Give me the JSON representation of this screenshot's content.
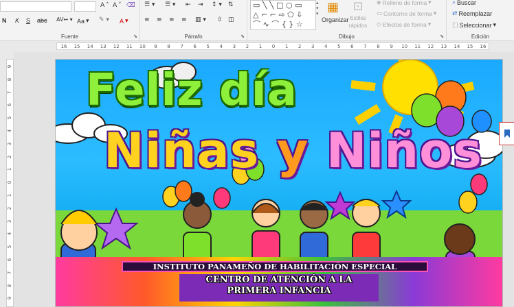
{
  "ribbon": {
    "groups": {
      "font_label": "Fuente",
      "paragraph_label": "Párrafo",
      "drawing_label": "Dibujo",
      "editing_label": "Edición"
    },
    "font": {
      "styles": [
        "N",
        "K",
        "S",
        "abc"
      ],
      "buttons": [
        "A",
        "A",
        "Aa",
        "A"
      ]
    },
    "drawing": {
      "arrange_label": "Organizar",
      "quick_styles_label": "Estilos rápidos",
      "shape_fill": "Relleno de forma",
      "shape_outline": "Contorno de forma",
      "shape_effects": "Efectos de forma"
    },
    "editing": {
      "find": "Buscar",
      "replace": "Reemplazar",
      "select": "Seleccionar"
    }
  },
  "ruler_h_ticks": [
    "16",
    "15",
    "14",
    "13",
    "12",
    "11",
    "10",
    "9",
    "8",
    "7",
    "6",
    "5",
    "4",
    "3",
    "2",
    "1",
    "0",
    "1",
    "2",
    "3",
    "4",
    "5",
    "6",
    "7",
    "8",
    "9",
    "10",
    "11",
    "12",
    "13",
    "14",
    "15",
    "16"
  ],
  "ruler_v_ticks": [
    "9",
    "8",
    "7",
    "6",
    "5",
    "4",
    "3",
    "2",
    "1",
    "0",
    "1",
    "2",
    "3",
    "4",
    "5",
    "6",
    "7",
    "8",
    "9"
  ],
  "slide": {
    "title_line1": "Feliz día",
    "title_line2_a": "Niñas",
    "title_line2_b": "y",
    "title_line2_c": "Niños",
    "institute": "INSTITUTO PANAMEÑO DE HABILITACIÓN ESPECIAL",
    "center_line1": "CENTRO DE ATENCIÓN A LA",
    "center_line2": "PRIMERA INFANCIA"
  },
  "colors": {
    "sky": "#1aa9ff",
    "title_green": "#8ef03a",
    "title_yellow": "#ffd21f",
    "title_pink": "#ff8fd8",
    "band_purple": "#2a0d3a"
  }
}
